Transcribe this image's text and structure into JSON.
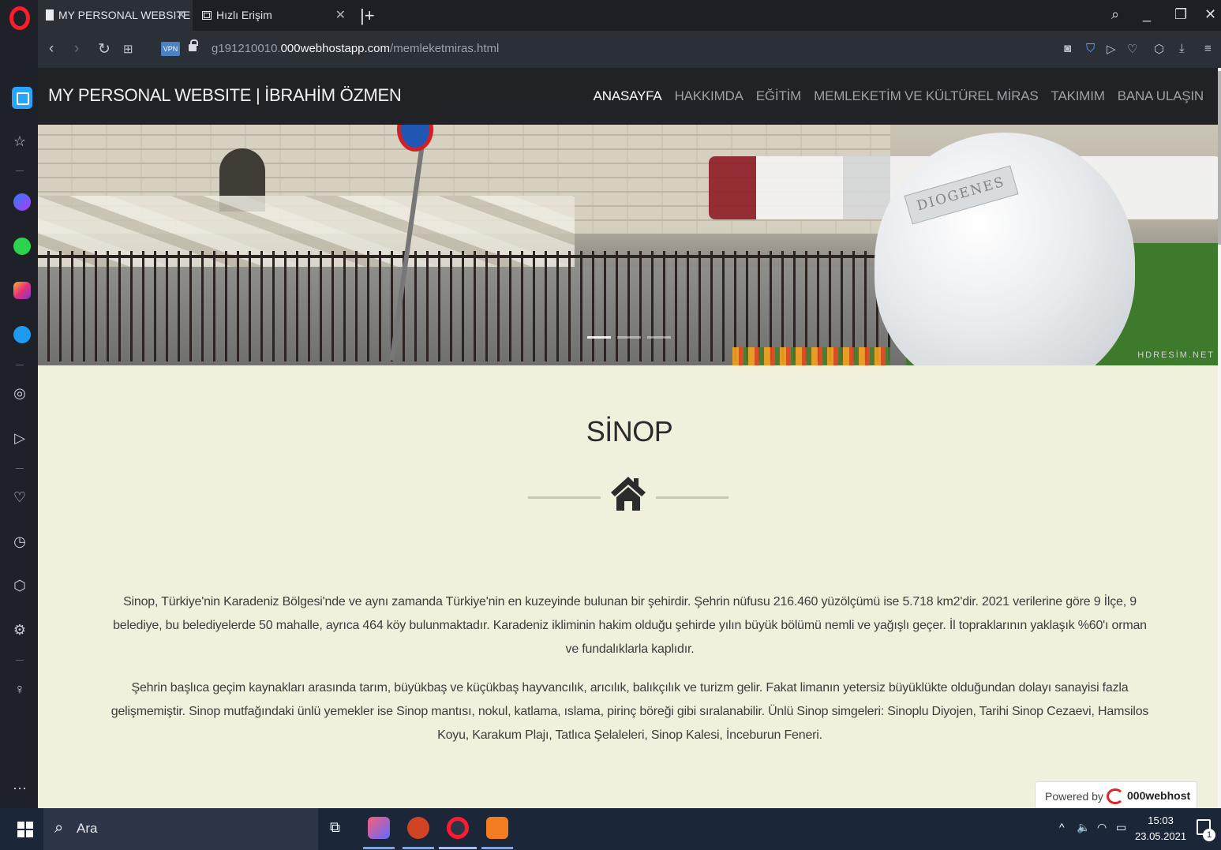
{
  "browser": {
    "tabs": [
      {
        "label": "MY PERSONAL WEBSITE | İ",
        "active": true
      },
      {
        "label": "Hızlı Erişim",
        "active": false
      }
    ],
    "vpn_label": "VPN",
    "url_prefix": "g191210010.",
    "url_domain": "000webhostapp.com",
    "url_path": "/memleketmiras.html"
  },
  "site": {
    "brand": "MY PERSONAL WEBSITE | İBRAHİM ÖZMEN",
    "nav": [
      {
        "label": "ANASAYFA",
        "active": true
      },
      {
        "label": "HAKKIMDA",
        "active": false
      },
      {
        "label": "EĞİTİM",
        "active": false
      },
      {
        "label": "MEMLEKETİM VE KÜLTÜREL MİRAS",
        "active": false
      },
      {
        "label": "TAKIMIM",
        "active": false
      },
      {
        "label": "BANA ULAŞIN",
        "active": false
      }
    ],
    "hero": {
      "statue_text": "DIOGENES",
      "watermark": "HDRESİM.NET"
    },
    "section_title": "SİNOP",
    "paragraphs": [
      "Sinop, Türkiye'nin Karadeniz Bölgesi'nde ve aynı zamanda Türkiye'nin en kuzeyinde bulunan bir şehirdir. Şehrin nüfusu 216.460 yüzölçümü ise 5.718 km2'dir. 2021 verilerine göre 9 İlçe, 9 belediye, bu belediyelerde 50 mahalle, ayrıca 464 köy bulunmaktadır. Karadeniz ikliminin hakim olduğu şehirde yılın büyük bölümü nemli ve yağışlı geçer. İl topraklarının yaklaşık %60'ı orman ve fundalıklarla kaplıdır.",
      "Şehrin başlıca geçim kaynakları arasında tarım, büyükbaş ve küçükbaş hayvancılık, arıcılık, balıkçılık ve turizm gelir. Fakat limanın yetersiz büyüklükte olduğundan dolayı sanayisi fazla gelişmemiştir. Sinop mutfağındaki ünlü yemekler ise Sinop mantısı, nokul, katlama, ıslama, pirinç böreği gibi sıralanabilir. Ünlü Sinop simgeleri: Sinoplu Diyojen, Tarihi Sinop Cezaevi, Hamsilos Koyu, Karakum Plajı, Tatlıca Şelaleleri, Sinop Kalesi, İnceburun Feneri."
    ],
    "powered_by": "Powered by",
    "powered_brand": "000webhost"
  },
  "taskbar": {
    "search_placeholder": "Ara",
    "time": "15:03",
    "date": "23.05.2021",
    "notification_count": "1"
  }
}
